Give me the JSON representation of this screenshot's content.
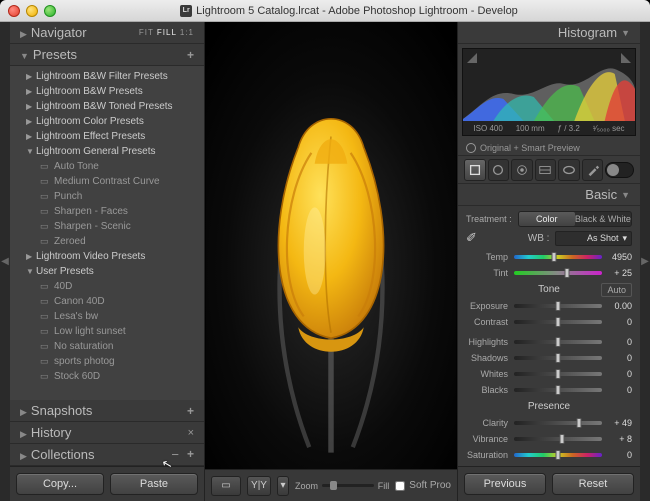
{
  "window": {
    "title": "Lightroom 5 Catalog.lrcat - Adobe Photoshop Lightroom - Develop",
    "app_badge": "Lr"
  },
  "left": {
    "navigator": {
      "title": "Navigator",
      "opts": {
        "fit": "FIT",
        "fill": "FILL",
        "oneone": "1:1"
      }
    },
    "presets": {
      "title": "Presets",
      "groups": [
        {
          "label": "Lightroom B&W Filter Presets",
          "open": false
        },
        {
          "label": "Lightroom B&W Presets",
          "open": false
        },
        {
          "label": "Lightroom B&W Toned Presets",
          "open": false
        },
        {
          "label": "Lightroom Color Presets",
          "open": false
        },
        {
          "label": "Lightroom Effect Presets",
          "open": false
        },
        {
          "label": "Lightroom General Presets",
          "open": true,
          "items": [
            "Auto Tone",
            "Medium Contrast Curve",
            "Punch",
            "Sharpen - Faces",
            "Sharpen - Scenic",
            "Zeroed"
          ]
        },
        {
          "label": "Lightroom Video Presets",
          "open": false
        },
        {
          "label": "User Presets",
          "open": true,
          "items": [
            "40D",
            "Canon 40D",
            "Lesa's bw",
            "Low light sunset",
            "No saturation",
            "sports photog",
            "Stock 60D"
          ]
        }
      ]
    },
    "snapshots": {
      "title": "Snapshots"
    },
    "history": {
      "title": "History"
    },
    "collections": {
      "title": "Collections"
    },
    "copy": "Copy...",
    "paste": "Paste"
  },
  "center": {
    "zoom_label": "Zoom",
    "fill_label": "Fill",
    "softproof": "Soft Proo"
  },
  "right": {
    "histogram": {
      "title": "Histogram",
      "iso": "ISO 400",
      "focal": "100 mm",
      "aperture": "ƒ / 3.2",
      "shutter": "¹⁄₅₀₀₀ sec",
      "orig": "Original + Smart Preview"
    },
    "basic": {
      "title": "Basic",
      "treatment_label": "Treatment :",
      "color": "Color",
      "bw": "Black & White",
      "wb_label": "WB :",
      "wb_value": "As Shot",
      "tone_label": "Tone",
      "auto": "Auto",
      "presence_label": "Presence",
      "sliders": {
        "temp": {
          "label": "Temp",
          "value": "4950",
          "pos": 45
        },
        "tint": {
          "label": "Tint",
          "value": "+ 25",
          "pos": 60
        },
        "exposure": {
          "label": "Exposure",
          "value": "0.00",
          "pos": 50
        },
        "contrast": {
          "label": "Contrast",
          "value": "0",
          "pos": 50
        },
        "highlights": {
          "label": "Highlights",
          "value": "0",
          "pos": 50
        },
        "shadows": {
          "label": "Shadows",
          "value": "0",
          "pos": 50
        },
        "whites": {
          "label": "Whites",
          "value": "0",
          "pos": 50
        },
        "blacks": {
          "label": "Blacks",
          "value": "0",
          "pos": 50
        },
        "clarity": {
          "label": "Clarity",
          "value": "+ 49",
          "pos": 74
        },
        "vibrance": {
          "label": "Vibrance",
          "value": "+ 8",
          "pos": 54
        },
        "saturation": {
          "label": "Saturation",
          "value": "0",
          "pos": 50
        }
      }
    },
    "previous": "Previous",
    "reset": "Reset"
  }
}
